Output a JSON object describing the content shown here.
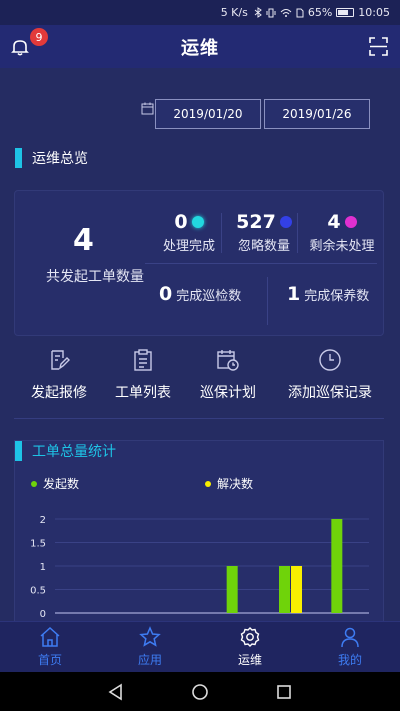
{
  "status_bar": {
    "speed": "5 K/s",
    "battery": "65%",
    "time": "10:05"
  },
  "header": {
    "title": "运维",
    "notification_count": "9"
  },
  "date_range": {
    "start": "2019/01/20",
    "end": "2019/01/26"
  },
  "overview": {
    "section_title": "运维总览",
    "total_count": "4",
    "total_label": "共发起工单数量",
    "stats": [
      {
        "value": "0",
        "label": "处理完成",
        "color": "#22d8e0"
      },
      {
        "value": "527",
        "label": "忽略数量",
        "color": "#3340e6"
      },
      {
        "value": "4",
        "label": "剩余未处理",
        "color": "#e030d0"
      }
    ],
    "inspection": {
      "value": "0",
      "label": "完成巡检数"
    },
    "maintenance": {
      "value": "1",
      "label": "完成保养数"
    }
  },
  "quick_actions": [
    {
      "label": "发起报修",
      "icon": "edit-icon"
    },
    {
      "label": "工单列表",
      "icon": "clipboard-icon"
    },
    {
      "label": "巡保计划",
      "icon": "calendar-clock-icon"
    },
    {
      "label": "添加巡保记录",
      "icon": "clock-icon"
    }
  ],
  "chart_section": {
    "title": "工单总量统计"
  },
  "chart_data": {
    "type": "bar",
    "series": [
      {
        "name": "发起数",
        "color": "#6fd30a",
        "values": [
          0,
          0,
          0,
          1,
          1,
          2
        ]
      },
      {
        "name": "解决数",
        "color": "#f8ef00",
        "values": [
          0,
          0,
          0,
          0,
          1,
          0
        ]
      }
    ],
    "y_ticks": [
      "0",
      "0.5",
      "1",
      "1.5",
      "2"
    ],
    "ylim": [
      0,
      2
    ],
    "grid": true
  },
  "tabs": [
    {
      "label": "首页",
      "icon": "home-icon",
      "active": false
    },
    {
      "label": "应用",
      "icon": "star-icon",
      "active": false
    },
    {
      "label": "运维",
      "icon": "gear-icon",
      "active": true
    },
    {
      "label": "我的",
      "icon": "person-icon",
      "active": false
    }
  ]
}
